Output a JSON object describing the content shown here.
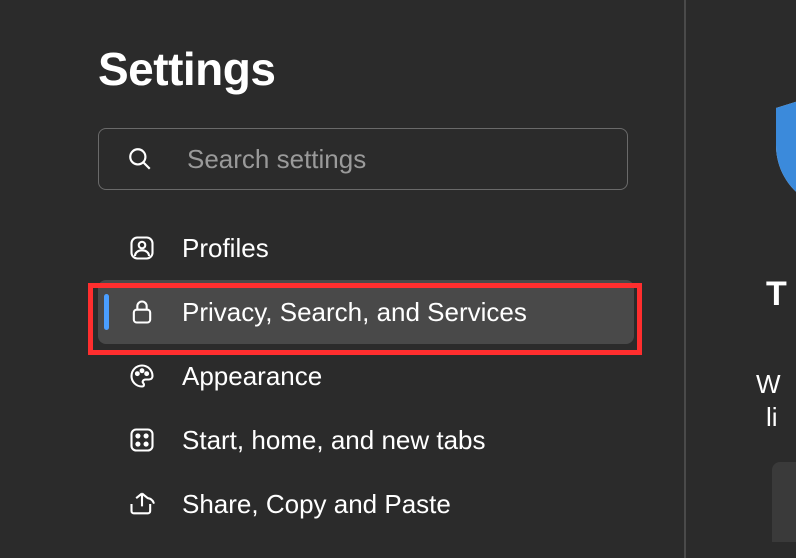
{
  "page_title": "Settings",
  "search": {
    "placeholder": "Search settings"
  },
  "sidebar": {
    "items": [
      {
        "label": "Profiles",
        "icon": "profile-icon",
        "selected": false
      },
      {
        "label": "Privacy, Search, and Services",
        "icon": "lock-icon",
        "selected": true
      },
      {
        "label": "Appearance",
        "icon": "palette-icon",
        "selected": false
      },
      {
        "label": "Start, home, and new tabs",
        "icon": "grid-icon",
        "selected": false
      },
      {
        "label": "Share, Copy and Paste",
        "icon": "share-icon",
        "selected": false
      }
    ]
  },
  "content_partial": {
    "heading_fragment": "T",
    "text_fragment_1": "W",
    "text_fragment_2": "li"
  }
}
